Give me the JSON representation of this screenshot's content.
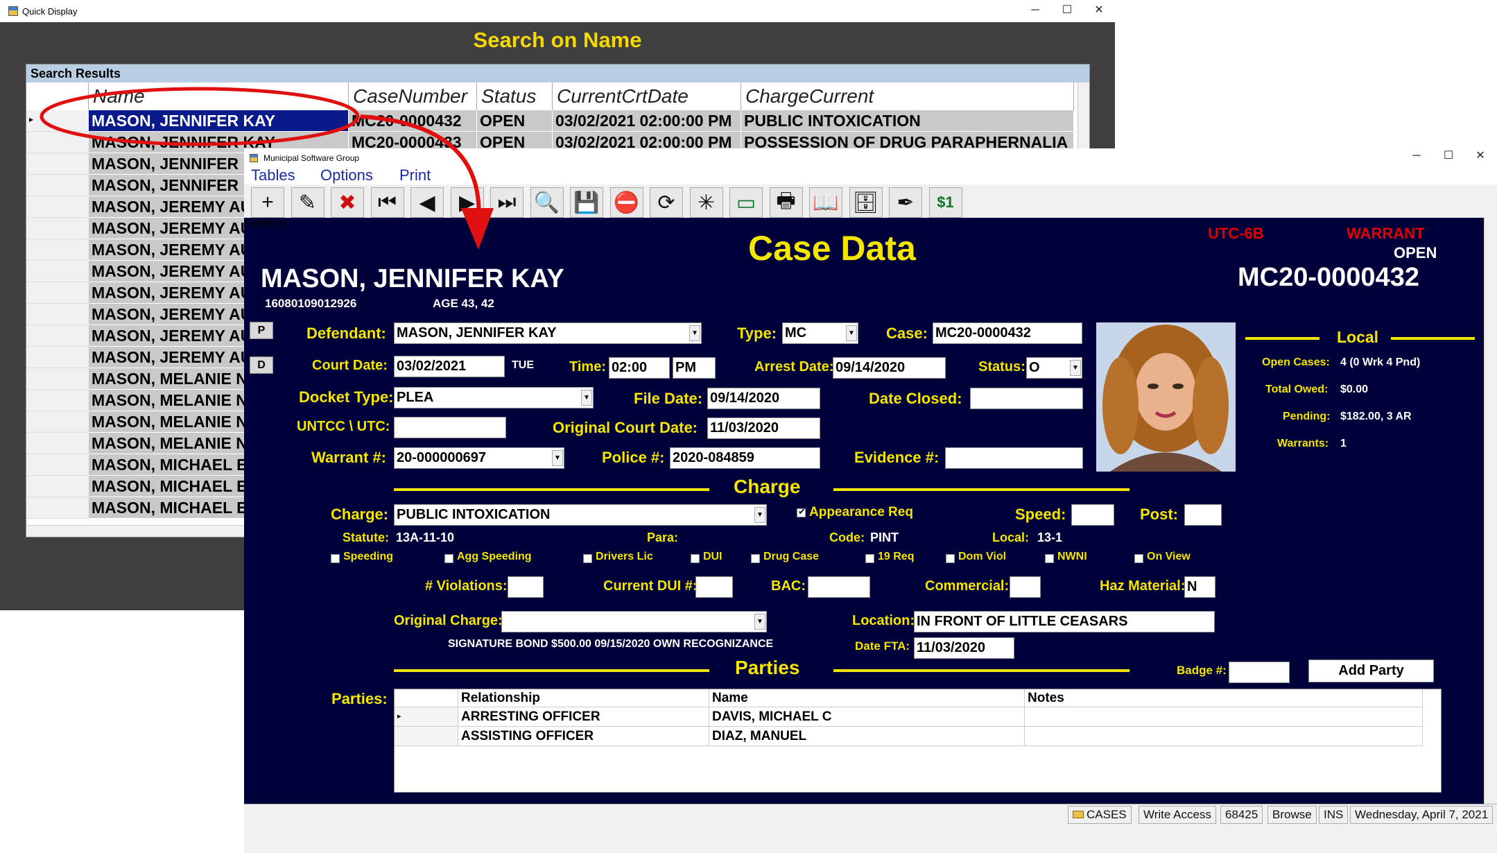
{
  "quick_display": {
    "window_title": "Quick Display",
    "title": "Search on Name",
    "grid_caption": "Search Results",
    "columns": [
      "Name",
      "CaseNumber",
      "Status",
      "CurrentCrtDate",
      "ChargeCurrent"
    ],
    "rows": [
      {
        "name": "MASON, JENNIFER KAY",
        "case": "MC20-0000432",
        "status": "OPEN",
        "date": "03/02/2021 02:00:00 PM",
        "charge": "PUBLIC INTOXICATION"
      },
      {
        "name": "MASON, JENNIFER KAY",
        "case": "MC20-0000433",
        "status": "OPEN",
        "date": "03/02/2021 02:00:00 PM",
        "charge": "POSSESSION OF DRUG PARAPHERNALIA"
      },
      {
        "name": "MASON, JENNIFER",
        "case": "",
        "status": "",
        "date": "",
        "charge": ""
      },
      {
        "name": "MASON, JENNIFER",
        "case": "",
        "status": "",
        "date": "",
        "charge": ""
      },
      {
        "name": "MASON, JEREMY AU",
        "case": "",
        "status": "",
        "date": "",
        "charge": ""
      },
      {
        "name": "MASON, JEREMY AU",
        "case": "",
        "status": "",
        "date": "",
        "charge": ""
      },
      {
        "name": "MASON, JEREMY AU",
        "case": "",
        "status": "",
        "date": "",
        "charge": ""
      },
      {
        "name": "MASON, JEREMY AU",
        "case": "",
        "status": "",
        "date": "",
        "charge": ""
      },
      {
        "name": "MASON, JEREMY AU",
        "case": "",
        "status": "",
        "date": "",
        "charge": ""
      },
      {
        "name": "MASON, JEREMY AU",
        "case": "",
        "status": "",
        "date": "",
        "charge": ""
      },
      {
        "name": "MASON, JEREMY AU",
        "case": "",
        "status": "",
        "date": "",
        "charge": ""
      },
      {
        "name": "MASON, JEREMY AU",
        "case": "",
        "status": "",
        "date": "",
        "charge": ""
      },
      {
        "name": "MASON, MELANIE N",
        "case": "",
        "status": "",
        "date": "",
        "charge": ""
      },
      {
        "name": "MASON, MELANIE N",
        "case": "",
        "status": "",
        "date": "",
        "charge": ""
      },
      {
        "name": "MASON, MELANIE N",
        "case": "",
        "status": "",
        "date": "",
        "charge": ""
      },
      {
        "name": "MASON, MELANIE N",
        "case": "",
        "status": "",
        "date": "",
        "charge": ""
      },
      {
        "name": "MASON, MICHAEL E",
        "case": "",
        "status": "",
        "date": "",
        "charge": ""
      },
      {
        "name": "MASON, MICHAEL E",
        "case": "",
        "status": "",
        "date": "",
        "charge": ""
      },
      {
        "name": "MASON, MICHAEL E",
        "case": "",
        "status": "",
        "date": "",
        "charge": ""
      }
    ]
  },
  "msg": {
    "window_title": "Municipal Software Group",
    "menu": [
      "Tables",
      "Options",
      "Print"
    ],
    "toolbar": [
      {
        "name": "add-record-icon",
        "glyph": "+"
      },
      {
        "name": "edit-icon",
        "glyph": "✎"
      },
      {
        "name": "delete-icon",
        "glyph": "✖"
      },
      {
        "name": "first-record-icon",
        "glyph": "⏮"
      },
      {
        "name": "previous-record-icon",
        "glyph": "◀"
      },
      {
        "name": "next-record-icon",
        "glyph": "▶"
      },
      {
        "name": "last-record-icon",
        "glyph": "⏭"
      },
      {
        "name": "search-icon",
        "glyph": "🔍"
      },
      {
        "name": "save-icon",
        "glyph": "💾"
      },
      {
        "name": "stop-icon",
        "glyph": "⛔"
      },
      {
        "name": "refresh-icon",
        "glyph": "⟳"
      },
      {
        "name": "network-icon",
        "glyph": "✳"
      },
      {
        "name": "table-icon",
        "glyph": "▭"
      },
      {
        "name": "printer-icon",
        "glyph": "🖶"
      },
      {
        "name": "book-icon",
        "glyph": "📖"
      },
      {
        "name": "cabinet-icon",
        "glyph": "🗄"
      },
      {
        "name": "signature-icon",
        "glyph": "✒"
      },
      {
        "name": "money-icon",
        "glyph": "$1"
      }
    ],
    "header": {
      "title": "Case Data",
      "utc": "UTC-6B",
      "warrant": "WARRANT",
      "status": "OPEN",
      "case_number": "MC20-0000432",
      "defendant_name": "MASON, JENNIFER KAY",
      "id_number": "16080109012926",
      "age": "AGE  43, 42"
    },
    "side_buttons": {
      "p": "P",
      "d": "D"
    },
    "labels": {
      "defendant": "Defendant:",
      "type": "Type:",
      "case": "Case:",
      "court_date": "Court Date:",
      "time": "Time:",
      "arrest_date": "Arrest Date:",
      "status": "Status:",
      "docket_type": "Docket Type:",
      "file_date": "File Date:",
      "date_closed": "Date Closed:",
      "untcc": "UNTCC \\ UTC:",
      "original_court_date": "Original Court Date:",
      "warrant": "Warrant #:",
      "police": "Police #:",
      "evidence": "Evidence #:",
      "charge_section": "Charge",
      "charge": "Charge:",
      "appearance": "Appearance Req",
      "speed": "Speed:",
      "post": "Post:",
      "statute": "Statute:",
      "para": "Para:",
      "code": "Code:",
      "local": "Local:",
      "violations": "# Violations:",
      "current_dui": "Current DUI #:",
      "bac": "BAC:",
      "commercial": "Commercial:",
      "haz": "Haz Material:",
      "original_charge": "Original Charge:",
      "location": "Location:",
      "date_fta": "Date FTA:",
      "parties_section": "Parties",
      "parties": "Parties:",
      "badge": "Badge #:"
    },
    "values": {
      "defendant": "MASON, JENNIFER KAY",
      "type": "MC",
      "case": "MC20-0000432",
      "court_date": "03/02/2021",
      "court_day": "TUE",
      "time": "02:00",
      "ampm": "PM",
      "arrest_date": "09/14/2020",
      "status": "O",
      "docket_type": "PLEA",
      "file_date": "09/14/2020",
      "date_closed": "",
      "untcc": "",
      "original_court_date": "11/03/2020",
      "warrant": "20-000000697",
      "police": "2020-084859",
      "evidence": "",
      "charge": "PUBLIC INTOXICATION",
      "speed": "",
      "post": "",
      "statute": "13A-11-10",
      "para": "",
      "code": "PINT",
      "local": "13-1",
      "violations": "",
      "current_dui": "",
      "bac": "",
      "commercial": "",
      "haz": "N",
      "original_charge": "",
      "location": "IN FRONT OF LITTLE CEASARS",
      "date_fta": "11/03/2020",
      "bond_info": "SIGNATURE BOND  $500.00  09/15/2020   OWN RECOGNIZANCE",
      "badge": ""
    },
    "checkboxes": [
      {
        "label": "Speeding",
        "checked": false
      },
      {
        "label": "Agg Speeding",
        "checked": false
      },
      {
        "label": "Drivers Lic",
        "checked": false
      },
      {
        "label": "DUI",
        "checked": false
      },
      {
        "label": "Drug Case",
        "checked": false
      },
      {
        "label": "19 Req",
        "checked": false
      },
      {
        "label": "Dom Viol",
        "checked": false
      },
      {
        "label": "NWNI",
        "checked": false
      },
      {
        "label": "On View",
        "checked": false
      }
    ],
    "appearance_checked": true,
    "local_panel": {
      "title": "Local",
      "open_cases_label": "Open Cases:",
      "open_cases": "4 (0 Wrk  4 Pnd)",
      "total_owed_label": "Total Owed:",
      "total_owed": "$0.00",
      "pending_label": "Pending:",
      "pending": "$182.00,  3 AR",
      "warrants_label": "Warrants:",
      "warrants": "1"
    },
    "parties_grid": {
      "columns": [
        "Relationship",
        "Name",
        "Notes"
      ],
      "rows": [
        {
          "relationship": "ARRESTING OFFICER",
          "name": "DAVIS, MICHAEL C",
          "notes": ""
        },
        {
          "relationship": "ASSISTING OFFICER",
          "name": "DIAZ, MANUEL",
          "notes": ""
        }
      ]
    },
    "add_party": "Add Party",
    "statusbar": [
      "CASES",
      "Write Access",
      "68425",
      "Browse",
      "INS",
      "Wednesday, April 7, 2021"
    ]
  },
  "colors": {
    "form_bg": "#00003a",
    "label_yellow": "#f5e600",
    "warrant_red": "#e00000",
    "annotation_red": "#e01010",
    "selection_blue": "#0a1a8a"
  }
}
